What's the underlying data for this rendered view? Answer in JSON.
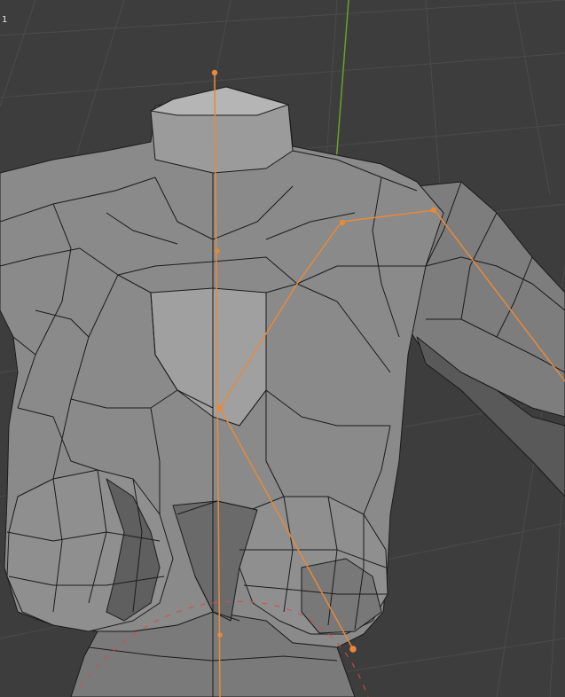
{
  "viewport": {
    "frame_indicator": "1"
  },
  "colors": {
    "background": "#3d3d3d",
    "grid": "#4a4a4a",
    "axis_y": "#6aa02a",
    "mesh_face": "#8a8a8a",
    "mesh_face_light": "#a3a3a3",
    "mesh_face_dark": "#6f6f6f",
    "mesh_edge": "#1b1b1b",
    "armature": "#e8893a",
    "constraint_dash": "#d94a4a"
  },
  "icons": {
    "armature": "bone-icon",
    "mesh": "mesh-icon"
  }
}
